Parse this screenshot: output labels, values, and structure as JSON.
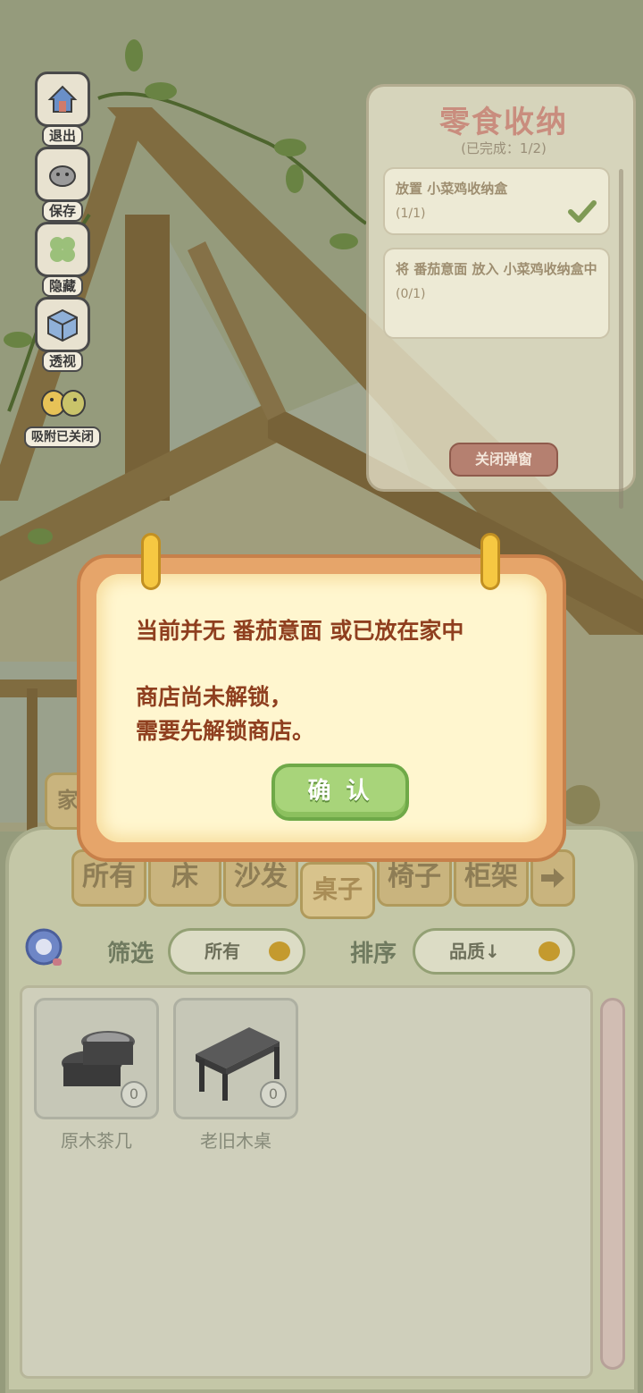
{
  "toolbar": {
    "exit_label": "退出",
    "save_label": "保存",
    "hide_label": "隐藏",
    "perspective_label": "透视",
    "snap_label": "吸附已关闭"
  },
  "quest": {
    "title": "零食收纳",
    "subtitle": "(已完成：1/2)",
    "tasks": [
      {
        "text": "放置 小菜鸡收纳盒",
        "progress": "(1/1)",
        "done": true
      },
      {
        "text": "将 番茄意面 放入 小菜鸡收纳盒中",
        "progress": "(0/1)",
        "done": false
      }
    ],
    "close_label": "关闭弹窗"
  },
  "dialog": {
    "line1": "当前并无 番茄意面 或已放在家中",
    "line2": "商店尚未解锁，",
    "line3": "需要先解锁商店。",
    "confirm_label": "确 认"
  },
  "categories": {
    "tab_partial": "家",
    "items": [
      "所有",
      "床",
      "沙发",
      "桌子",
      "椅子",
      "柜架"
    ],
    "active": "桌子"
  },
  "filter": {
    "label": "筛选",
    "value": "所有"
  },
  "sort": {
    "label": "排序",
    "value": "品质↓"
  },
  "items": [
    {
      "name": "原木茶几",
      "qty": "0"
    },
    {
      "name": "老旧木桌",
      "qty": "0"
    }
  ],
  "colors": {
    "dialog_text": "#8f3f1f",
    "confirm_green": "#a8d47a",
    "quest_title": "#c98d7e"
  }
}
